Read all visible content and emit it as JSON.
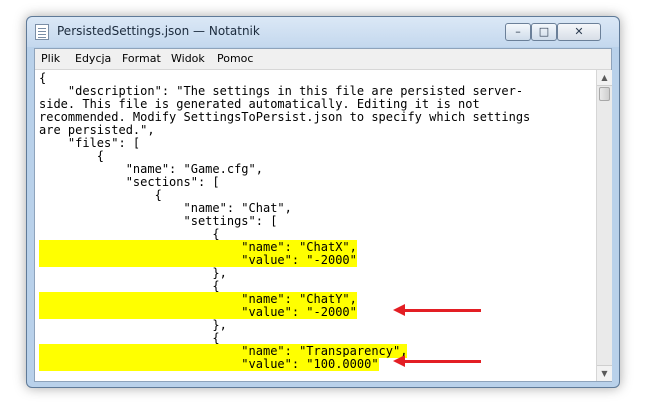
{
  "window": {
    "title": "PersistedSettings.json — Notatnik"
  },
  "controls": {
    "minimize": "–",
    "maximize": "□",
    "close": "✕"
  },
  "menu": [
    "Plik",
    "Edycja",
    "Format",
    "Widok",
    "Pomoc"
  ],
  "scrollbar": {
    "up": "▲",
    "down": "▼"
  },
  "lines": [
    "{",
    "    \"description\": \"The settings in this file are persisted server-",
    "side. This file is generated automatically. Editing it is not",
    "recommended. Modify SettingsToPersist.json to specify which settings",
    "are persisted.\",",
    "    \"files\": [",
    "        {",
    "            \"name\": \"Game.cfg\",",
    "            \"sections\": [",
    "                {",
    "                    \"name\": \"Chat\",",
    "                    \"settings\": [",
    "                        {",
    "                            \"name\": \"ChatX\",",
    "                            \"value\": \"-2000\"",
    "                        },",
    "                        {",
    "                            \"name\": \"ChatY\",",
    "                            \"value\": \"-2000\"",
    "                        },",
    "                        {",
    "                            \"name\": \"Transparency\",",
    "                            \"value\": \"100.0000\""
  ],
  "annotation_color": "#e31e24",
  "highlight_color": "#ffff00"
}
